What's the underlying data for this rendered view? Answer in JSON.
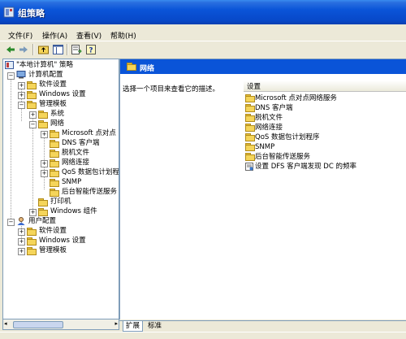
{
  "window": {
    "title": "组策略",
    "icon": "policy-window-icon"
  },
  "menu": {
    "file": "文件(F)",
    "action": "操作(A)",
    "view": "查看(V)",
    "help": "帮助(H)"
  },
  "toolbar": {
    "icons": [
      "back-arrow-icon",
      "forward-arrow-icon",
      "up-folder-icon",
      "show-tree-icon",
      "export-list-icon",
      "help-icon"
    ]
  },
  "tree": {
    "root": "\"本地计算机\" 策略",
    "computer_config": "计算机配置",
    "software_settings": "软件设置",
    "windows_settings": "Windows 设置",
    "admin_templates": "管理模板",
    "system": "系统",
    "network": "网络",
    "net_children": [
      "Microsoft 点对点",
      "DNS 客户端",
      "脱机文件",
      "网络连接",
      "QoS 数据包计划程",
      "SNMP",
      "后台智能传送服务"
    ],
    "printers": "打印机",
    "windows_components": "Windows 组件",
    "user_config": "用户配置",
    "user_software": "软件设置",
    "user_windows": "Windows 设置",
    "user_admin": "管理模板"
  },
  "detail": {
    "header": "网络",
    "description": "选择一个项目来查看它的描述。",
    "column": "设置",
    "items": [
      {
        "label": "Microsoft 点对点网络服务",
        "icon": "folder-icon"
      },
      {
        "label": "DNS 客户端",
        "icon": "folder-icon"
      },
      {
        "label": "脱机文件",
        "icon": "folder-icon"
      },
      {
        "label": "网络连接",
        "icon": "folder-icon"
      },
      {
        "label": "QoS 数据包计划程序",
        "icon": "folder-icon"
      },
      {
        "label": "SNMP",
        "icon": "folder-icon"
      },
      {
        "label": "后台智能传送服务",
        "icon": "folder-icon"
      },
      {
        "label": "设置 DFS 客户端发现 DC 的频率",
        "icon": "setting-icon"
      }
    ]
  },
  "tabs": {
    "extended": "扩展",
    "standard": "标准"
  },
  "colors": {
    "title_blue": "#0a54d8",
    "folder_yellow": "#f5d55a",
    "chrome": "#ece9d8"
  }
}
